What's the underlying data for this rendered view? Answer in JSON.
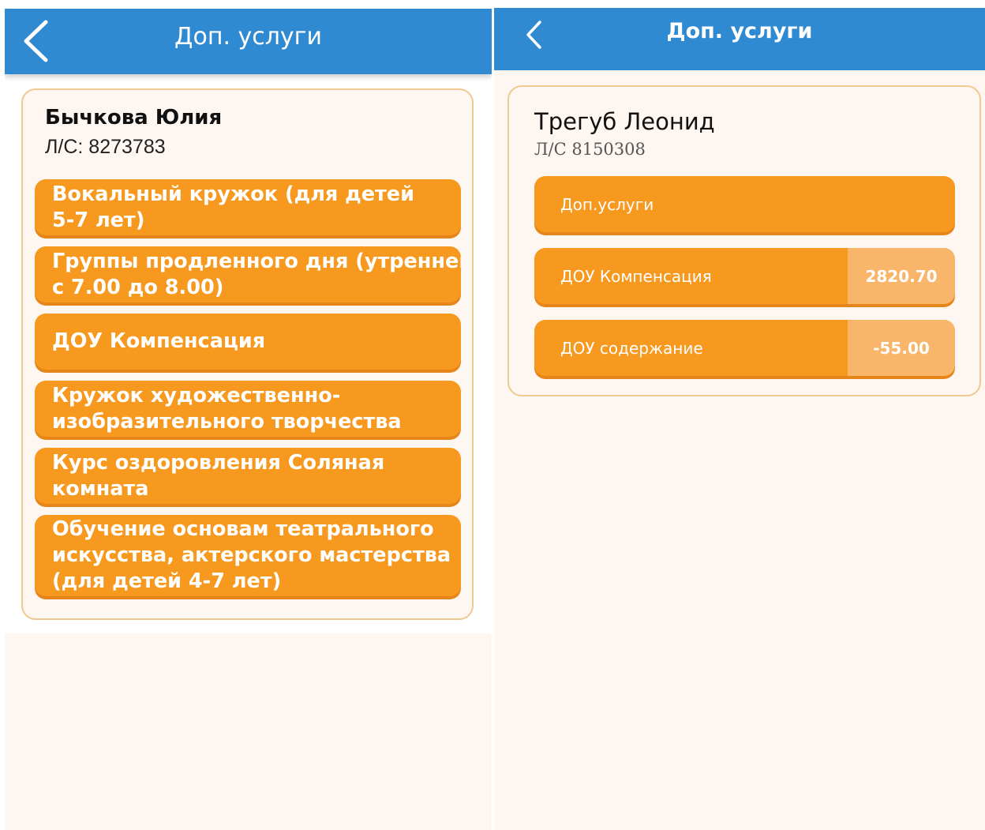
{
  "left": {
    "title": "Доп. услуги",
    "person": {
      "name": "Бычкова Юлия",
      "account": "Л/С: 8273783"
    },
    "services": [
      {
        "line1": "Вокальный кружок (для детей",
        "line2": "5-7 лет)"
      },
      {
        "line1": "Группы продленного дня (утреннего",
        "line2": "с 7.00 до 8.00)"
      },
      {
        "line1": "ДОУ Компенсация"
      },
      {
        "line1": "Кружок художественно-",
        "line2": "изобразительного творчества"
      },
      {
        "line1": "Курс оздоровления Соляная",
        "line2": "комната"
      },
      {
        "line1": "Обучение основам театрального",
        "line2": "искусства, актерского мастерства",
        "line3": "(для детей 4-7 лет)"
      }
    ]
  },
  "right": {
    "title": "Доп. услуги",
    "person": {
      "name": "Трегуб Леонид",
      "account": "Л/С 8150308"
    },
    "services": [
      {
        "label": "Доп.услуги"
      },
      {
        "label": "ДОУ Компенсация",
        "amount": "2820.70"
      },
      {
        "label": "ДОУ содержание",
        "amount": "-55.00"
      }
    ]
  },
  "colors": {
    "appbar": "#2f8ad2",
    "button": "#f7991f",
    "amount_bg": "#f9b56a",
    "card_border": "#f0c98f",
    "background": "#fdf6f1"
  },
  "icons": {
    "back": "chevron-left-icon"
  }
}
